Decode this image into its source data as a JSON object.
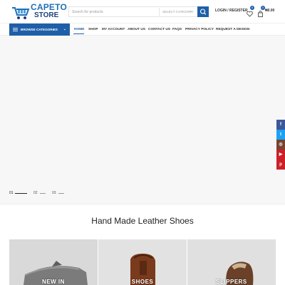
{
  "header": {
    "logo_line1": "CAPETO",
    "logo_line2": "STORE",
    "search_placeholder": "Search for products",
    "search_category": "SELECT CATEGORY",
    "login_label": "LOGIN / REGISTER",
    "wishlist_count": "0",
    "cart_count": "0",
    "cart_total": "₦0.00"
  },
  "nav": {
    "browse_label": "BROWSE CATEGORIES",
    "items": [
      "HOME",
      "SHOP",
      "MY ACCOUNT",
      "ABOUT US",
      "CONTACT US",
      "FAQS",
      "PRIVACY POLICY",
      "REQUEST A DESIGN"
    ]
  },
  "slider": {
    "dots": [
      "01",
      "02",
      "03"
    ]
  },
  "social": [
    {
      "icon": "facebook-icon",
      "glyph": "f",
      "color": "#3b5998"
    },
    {
      "icon": "twitter-icon",
      "glyph": "t",
      "color": "#1da1f2"
    },
    {
      "icon": "instagram-icon",
      "glyph": "◎",
      "color": "#774430"
    },
    {
      "icon": "youtube-icon",
      "glyph": "▶",
      "color": "#cb2027"
    },
    {
      "icon": "pinterest-icon",
      "glyph": "p",
      "color": "#cb2027"
    }
  ],
  "section": {
    "title": "Hand Made Leather Shoes",
    "cards": [
      {
        "label": "NEW IN"
      },
      {
        "label": "SHOES"
      },
      {
        "label": "SLIPPERS"
      }
    ]
  },
  "colors": {
    "accent": "#1f5fa8"
  }
}
